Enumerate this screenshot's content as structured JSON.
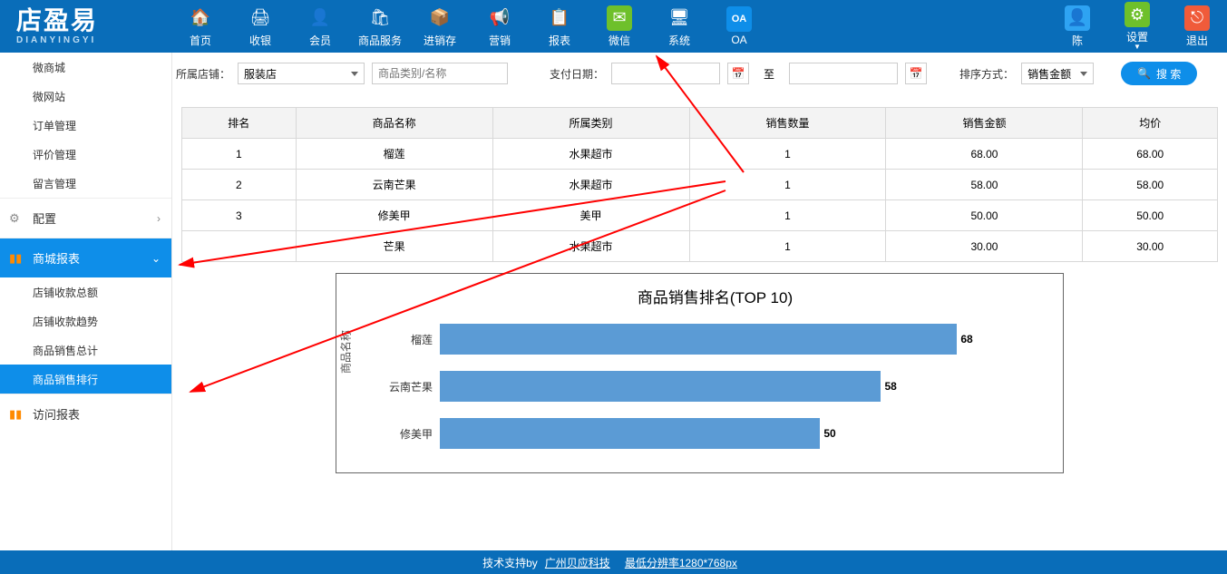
{
  "brand": {
    "main": "店盈易",
    "sub": "DIANYINGYI"
  },
  "nav": {
    "items": [
      {
        "id": "home",
        "label": "首页",
        "color": "#fff"
      },
      {
        "id": "cashier",
        "label": "收银",
        "color": "#fff"
      },
      {
        "id": "member",
        "label": "会员",
        "color": "#fff"
      },
      {
        "id": "goods",
        "label": "商品服务",
        "color": "#fff"
      },
      {
        "id": "stock",
        "label": "进销存",
        "color": "#fff"
      },
      {
        "id": "marketing",
        "label": "营销",
        "color": "#fff"
      },
      {
        "id": "report",
        "label": "报表",
        "color": "#fff"
      },
      {
        "id": "wechat",
        "label": "微信",
        "color": "#6ec02b"
      },
      {
        "id": "system",
        "label": "系统",
        "color": "#fff"
      },
      {
        "id": "oa",
        "label": "OA",
        "color": "#0e8ee9"
      }
    ],
    "right": [
      {
        "id": "user",
        "label": "陈",
        "color": "#2ea3f2"
      },
      {
        "id": "settings",
        "label": "设置",
        "color": "#6ec02b"
      },
      {
        "id": "exit",
        "label": "退出",
        "color": "#f05b3a"
      }
    ]
  },
  "filters": {
    "store_label": "所属店铺：",
    "store_value": "服装店",
    "goods_placeholder": "商品类别/名称",
    "date_label": "支付日期：",
    "to": "至",
    "sort_label": "排序方式：",
    "sort_value": "销售金额",
    "search": "搜 索"
  },
  "sidebar": {
    "plain": [
      {
        "id": "wsc",
        "label": "微商城"
      },
      {
        "id": "wwz",
        "label": "微网站"
      },
      {
        "id": "order",
        "label": "订单管理"
      },
      {
        "id": "review",
        "label": "评价管理"
      },
      {
        "id": "guestbook",
        "label": "留言管理"
      }
    ],
    "group_config": {
      "label": "配置",
      "icon": "⚙"
    },
    "group_mall": {
      "label": "商城报表",
      "icon": "▮",
      "active": true
    },
    "mall_subs": [
      {
        "id": "shop-total",
        "label": "店铺收款总额"
      },
      {
        "id": "shop-trend",
        "label": "店铺收款趋势"
      },
      {
        "id": "goods-total",
        "label": "商品销售总计"
      },
      {
        "id": "goods-rank",
        "label": "商品销售排行",
        "active": true
      }
    ],
    "group_visit": {
      "label": "访问报表",
      "icon": "▮"
    }
  },
  "table": {
    "headers": [
      "排名",
      "商品名称",
      "所属类别",
      "销售数量",
      "销售金额",
      "均价"
    ],
    "rows": [
      [
        "1",
        "榴莲",
        "水果超市",
        "1",
        "68.00",
        "68.00"
      ],
      [
        "2",
        "云南芒果",
        "水果超市",
        "1",
        "58.00",
        "58.00"
      ],
      [
        "3",
        "修美甲",
        "美甲",
        "1",
        "50.00",
        "50.00"
      ],
      [
        "",
        "芒果",
        "水果超市",
        "1",
        "30.00",
        "30.00"
      ]
    ]
  },
  "chart_data": {
    "type": "bar",
    "orientation": "horizontal",
    "title": "商品销售排名(TOP 10)",
    "ylabel": "商品名称",
    "xlim": [
      0,
      80
    ],
    "categories": [
      "榴莲",
      "云南芒果",
      "修美甲"
    ],
    "values": [
      68,
      58,
      50
    ]
  },
  "footer": {
    "support_prefix": "技术支持by ",
    "support_link": "广州贝应科技",
    "res": "最低分辨率1280*768px"
  }
}
